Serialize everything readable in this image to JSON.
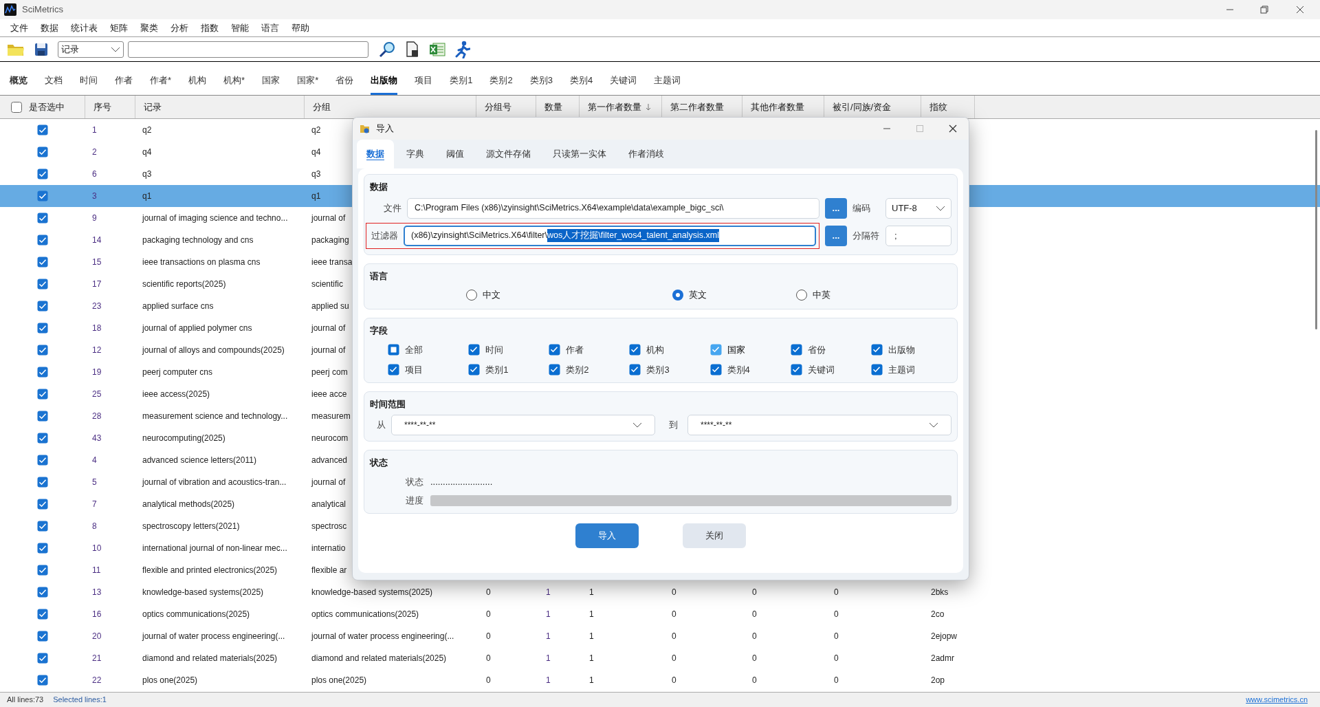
{
  "window": {
    "title": "SciMetrics"
  },
  "menu": [
    "文件",
    "数据",
    "统计表",
    "矩阵",
    "聚类",
    "分析",
    "指数",
    "智能",
    "语言",
    "帮助"
  ],
  "toolbar": {
    "scope": "记录"
  },
  "tabs": [
    {
      "label": "概览",
      "selected": false,
      "bold": true
    },
    {
      "label": "文档",
      "selected": false,
      "bold": false
    },
    {
      "label": "时间",
      "selected": false,
      "bold": false
    },
    {
      "label": "作者",
      "selected": false,
      "bold": false
    },
    {
      "label": "作者*",
      "selected": false,
      "bold": false
    },
    {
      "label": "机构",
      "selected": false,
      "bold": false
    },
    {
      "label": "机构*",
      "selected": false,
      "bold": false
    },
    {
      "label": "国家",
      "selected": false,
      "bold": false
    },
    {
      "label": "国家*",
      "selected": false,
      "bold": false
    },
    {
      "label": "省份",
      "selected": false,
      "bold": false
    },
    {
      "label": "出版物",
      "selected": true,
      "bold": true
    },
    {
      "label": "项目",
      "selected": false,
      "bold": false
    },
    {
      "label": "类别1",
      "selected": false,
      "bold": false
    },
    {
      "label": "类别2",
      "selected": false,
      "bold": false
    },
    {
      "label": "类别3",
      "selected": false,
      "bold": false
    },
    {
      "label": "类别4",
      "selected": false,
      "bold": false
    },
    {
      "label": "关键词",
      "selected": false,
      "bold": false
    },
    {
      "label": "主题词",
      "selected": false,
      "bold": false
    }
  ],
  "table": {
    "select_all": {
      "label": "是否选中",
      "checked": false
    },
    "columns": [
      {
        "label": "序号"
      },
      {
        "label": "记录"
      },
      {
        "label": "分组"
      },
      {
        "label": "分组号"
      },
      {
        "label": "数量"
      },
      {
        "label": "第一作者数量",
        "sorted": true
      },
      {
        "label": "第二作者数量"
      },
      {
        "label": "其他作者数量"
      },
      {
        "label": "被引/同族/资金"
      },
      {
        "label": "指纹"
      }
    ],
    "rows": [
      {
        "checked": true,
        "selected": false,
        "no": "1",
        "record": "q2",
        "group": "q2"
      },
      {
        "checked": true,
        "selected": false,
        "no": "2",
        "record": "q4",
        "group": "q4"
      },
      {
        "checked": true,
        "selected": false,
        "no": "6",
        "record": "q3",
        "group": "q3"
      },
      {
        "checked": true,
        "selected": true,
        "no": "3",
        "record": "q1",
        "group": "q1"
      },
      {
        "checked": true,
        "selected": false,
        "no": "9",
        "record": "journal of imaging science and techno...",
        "group": "journal of"
      },
      {
        "checked": true,
        "selected": false,
        "no": "14",
        "record": "packaging technology and cns",
        "group": "packaging"
      },
      {
        "checked": true,
        "selected": false,
        "no": "15",
        "record": "ieee transactions on plasma cns",
        "group": "ieee transa"
      },
      {
        "checked": true,
        "selected": false,
        "no": "17",
        "record": "scientific reports(2025)",
        "group": "scientific"
      },
      {
        "checked": true,
        "selected": false,
        "no": "23",
        "record": "applied surface cns",
        "group": "applied su"
      },
      {
        "checked": true,
        "selected": false,
        "no": "18",
        "record": "journal of applied polymer cns",
        "group": "journal of"
      },
      {
        "checked": true,
        "selected": false,
        "no": "12",
        "record": "journal of alloys and compounds(2025)",
        "group": "journal of"
      },
      {
        "checked": true,
        "selected": false,
        "no": "19",
        "record": "peerj computer cns",
        "group": "peerj com"
      },
      {
        "checked": true,
        "selected": false,
        "no": "25",
        "record": "ieee access(2025)",
        "group": "ieee acce"
      },
      {
        "checked": true,
        "selected": false,
        "no": "28",
        "record": "measurement science and technology...",
        "group": "measurem"
      },
      {
        "checked": true,
        "selected": false,
        "no": "43",
        "record": "neurocomputing(2025)",
        "group": "neurocom"
      },
      {
        "checked": true,
        "selected": false,
        "no": "4",
        "record": "advanced science letters(2011)",
        "group": "advanced"
      },
      {
        "checked": true,
        "selected": false,
        "no": "5",
        "record": "journal of vibration and acoustics-tran...",
        "group": "journal of"
      },
      {
        "checked": true,
        "selected": false,
        "no": "7",
        "record": "analytical methods(2025)",
        "group": "analytical"
      },
      {
        "checked": true,
        "selected": false,
        "no": "8",
        "record": "spectroscopy letters(2021)",
        "group": "spectrosc"
      },
      {
        "checked": true,
        "selected": false,
        "no": "10",
        "record": "international journal of non-linear mec...",
        "group": "internatio"
      },
      {
        "checked": true,
        "selected": false,
        "no": "11",
        "record": "flexible and printed electronics(2025)",
        "group": "flexible ar"
      },
      {
        "checked": true,
        "selected": false,
        "no": "13",
        "record": "knowledge-based systems(2025)",
        "group": "knowledge-based systems(2025)",
        "cells": [
          "0",
          "1",
          "1",
          "0",
          "0",
          "0",
          "2bks"
        ]
      },
      {
        "checked": true,
        "selected": false,
        "no": "16",
        "record": "optics communications(2025)",
        "group": "optics communications(2025)",
        "cells": [
          "0",
          "1",
          "1",
          "0",
          "0",
          "0",
          "2co"
        ]
      },
      {
        "checked": true,
        "selected": false,
        "no": "20",
        "record": "journal of water process engineering(...",
        "group": "journal of water process engineering(...",
        "cells": [
          "0",
          "1",
          "1",
          "0",
          "0",
          "0",
          "2ejopw"
        ]
      },
      {
        "checked": true,
        "selected": false,
        "no": "21",
        "record": "diamond and related materials(2025)",
        "group": "diamond and related materials(2025)",
        "cells": [
          "0",
          "1",
          "1",
          "0",
          "0",
          "0",
          "2admr"
        ]
      },
      {
        "checked": true,
        "selected": false,
        "no": "22",
        "record": "plos one(2025)",
        "group": "plos one(2025)",
        "cells": [
          "0",
          "1",
          "1",
          "0",
          "0",
          "0",
          "2op"
        ]
      }
    ]
  },
  "status_bar": {
    "all_lines": "All lines:73",
    "selected_lines": "Selected lines:1",
    "link": "www.scimetrics.cn"
  },
  "dialog": {
    "title": "导入",
    "tabs": [
      {
        "label": "数据",
        "selected": true
      },
      {
        "label": "字典",
        "selected": false
      },
      {
        "label": "阈值",
        "selected": false
      },
      {
        "label": "源文件存储",
        "selected": false
      },
      {
        "label": "只读第一实体",
        "selected": false
      },
      {
        "label": "作者消歧",
        "selected": false
      }
    ],
    "data_section": {
      "title": "数据",
      "file_label": "文件",
      "file_path": "C:\\Program Files (x86)\\zyinsight\\SciMetrics.X64\\example\\data\\example_bigc_sci\\",
      "file_browse": "...",
      "encoding_label": "编码",
      "encoding": "UTF-8",
      "filter_label": "过滤器",
      "filter_path": "(x86)\\zyinsight\\SciMetrics.X64\\filter\\",
      "filter_selected": "wos人才挖掘\\filter_wos4_talent_analysis.xml",
      "filter_browse": "...",
      "separator_label": "分隔符",
      "separator": ";"
    },
    "language_section": {
      "title": "语言",
      "options": [
        {
          "label": "中文",
          "selected": false
        },
        {
          "label": "英文",
          "selected": true
        },
        {
          "label": "中英",
          "selected": false
        }
      ]
    },
    "fields_section": {
      "title": "字段",
      "items": [
        {
          "label": "全部",
          "checked": false,
          "indeterminate": true,
          "hovered": false
        },
        {
          "label": "时间",
          "checked": true,
          "indeterminate": false,
          "hovered": false
        },
        {
          "label": "作者",
          "checked": true,
          "indeterminate": false,
          "hovered": false
        },
        {
          "label": "机构",
          "checked": true,
          "indeterminate": false,
          "hovered": false
        },
        {
          "label": "国家",
          "checked": true,
          "indeterminate": false,
          "hovered": true
        },
        {
          "label": "省份",
          "checked": true,
          "indeterminate": false,
          "hovered": false
        },
        {
          "label": "出版物",
          "checked": true,
          "indeterminate": false,
          "hovered": false
        },
        {
          "label": "项目",
          "checked": true,
          "indeterminate": false,
          "hovered": false
        },
        {
          "label": "类别1",
          "checked": true,
          "indeterminate": false,
          "hovered": false
        },
        {
          "label": "类别2",
          "checked": true,
          "indeterminate": false,
          "hovered": false
        },
        {
          "label": "类别3",
          "checked": true,
          "indeterminate": false,
          "hovered": false
        },
        {
          "label": "类别4",
          "checked": true,
          "indeterminate": false,
          "hovered": false
        },
        {
          "label": "关键词",
          "checked": true,
          "indeterminate": false,
          "hovered": false
        },
        {
          "label": "主题词",
          "checked": true,
          "indeterminate": false,
          "hovered": false
        }
      ]
    },
    "time_section": {
      "title": "时间范围",
      "from_label": "从",
      "from": "****-**-**",
      "to_label": "到",
      "to": "****-**-**"
    },
    "status_section": {
      "title": "状态",
      "status_label": "状态",
      "status": ".........................",
      "progress_label": "进度",
      "progress": {
        "level": 0
      }
    },
    "buttons": [
      {
        "label": "导入",
        "kind": "primary"
      },
      {
        "label": "关闭",
        "kind": "secondary"
      }
    ]
  }
}
